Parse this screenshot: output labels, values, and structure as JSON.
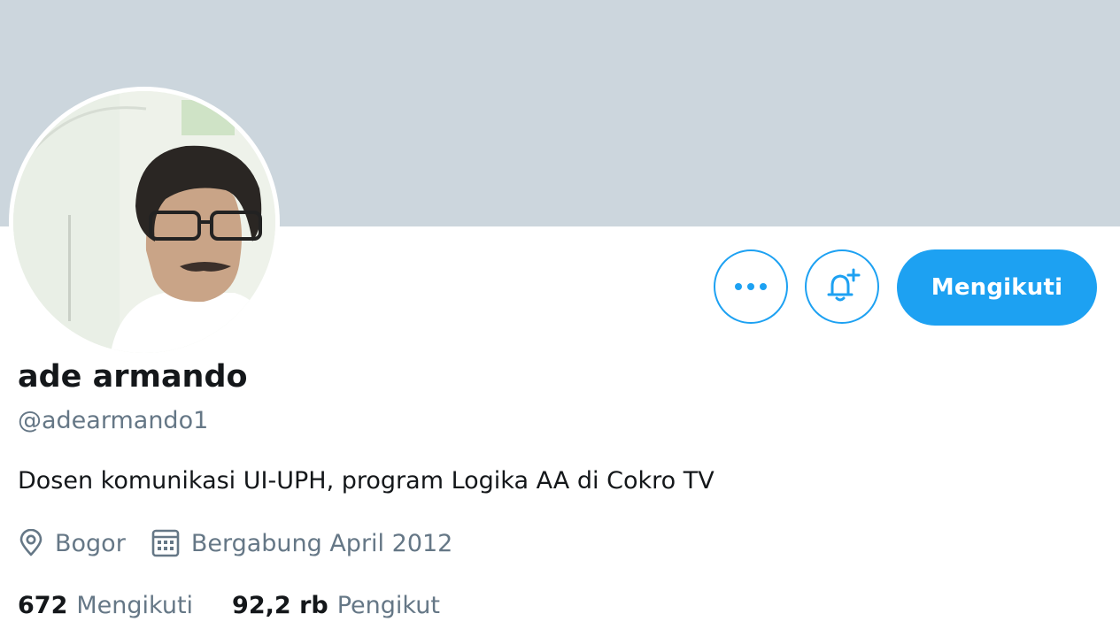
{
  "profile": {
    "name": "ade armando",
    "handle": "@adearmando1",
    "bio": "Dosen komunikasi UI-UPH, program Logika AA di Cokro TV",
    "location": "Bogor",
    "joined": "Bergabung April 2012"
  },
  "actions": {
    "more_icon": "more-horizontal-icon",
    "bell_icon": "bell-plus-icon",
    "follow_label": "Mengikuti"
  },
  "stats": {
    "following_count": "672",
    "following_label": "Mengikuti",
    "followers_count": "92,2 rb",
    "followers_label": "Pengikut"
  },
  "colors": {
    "accent": "#1da1f2",
    "banner": "#ccd6dd",
    "secondary_text": "#657786",
    "primary_text": "#14171a"
  }
}
